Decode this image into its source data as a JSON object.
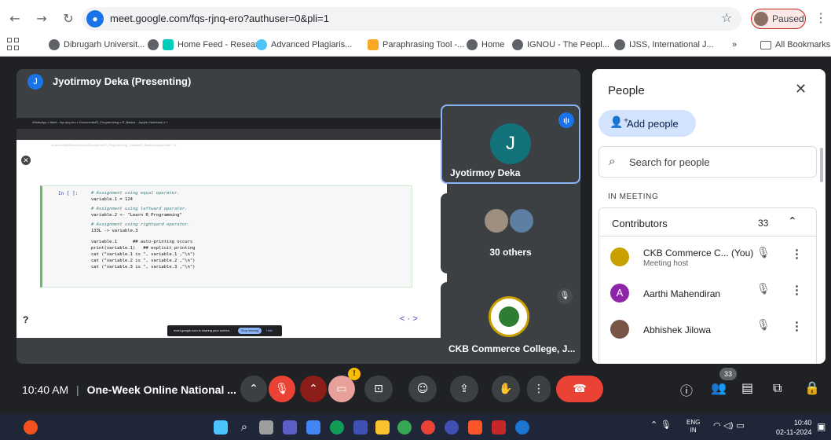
{
  "browser": {
    "url": "meet.google.com/fqs-rjnq-ero?authuser=0&pli=1",
    "profile_status": "Paused",
    "bookmarks": [
      "Dibrugarh Universit...",
      "Home Feed - Resear...",
      "Advanced Plagiaris...",
      "Paraphrasing Tool -...",
      "Home",
      "IGNOU - The Peopl...",
      "IJSS, International J..."
    ],
    "bookmarks_overflow": "»",
    "all_bookmarks": "All Bookmarks"
  },
  "stage": {
    "presenter_initial": "J",
    "presenter_label": "Jyotirmoy Deka (Presenting)"
  },
  "shared_screen": {
    "tabs_text": "WhatsApp   x  Meet - fqs-rjnq-ero   x   Documents/R_Programming   x   R_Basics - Jupyter Notebook   x  +",
    "url_text": "localhost:8888/notebooks/Documents/R_Programming_Tutorial/R_Basics.ipynb#Slide-7-9",
    "cell_prompt": "In [ ]:",
    "code_lines": [
      {
        "text": "# Assignment using equal operator.",
        "comment": true
      },
      {
        "text": "variable.1 = 124",
        "comment": false
      },
      {
        "text": "# Assignment using leftward operator.",
        "comment": true
      },
      {
        "text": "variable.2 <- \"Learn R Programming\"",
        "comment": false
      },
      {
        "text": "# Assignment using rightward operator.",
        "comment": true
      },
      {
        "text": "133L -> variable.3",
        "comment": false
      },
      {
        "text": "variable.1      ## auto-printing occurs",
        "comment": false
      },
      {
        "text": "print(variable.1)   ## explicit printing",
        "comment": false
      },
      {
        "text": "cat (\"variable.1 is \", variable.1 ,\"\\n\")",
        "comment": false
      },
      {
        "text": "cat (\"variable.2 is \", variable.2 ,\"\\n\")",
        "comment": false
      },
      {
        "text": "cat (\"variable.3 is \", variable.3 ,\"\\n\")",
        "comment": false
      }
    ],
    "help_mark": "?",
    "pager": "< · >",
    "share_text": "meet.google.com is sharing your screen.",
    "stop_sharing": "Stop sharing",
    "hide": "Hide"
  },
  "tiles": {
    "jyotirmoy": {
      "initial": "J",
      "name": "Jyotirmoy Deka"
    },
    "others": {
      "label": "30 others"
    },
    "ckb": {
      "name": "CKB Commerce College, J..."
    }
  },
  "people_panel": {
    "title": "People",
    "add_people": "Add people",
    "search_placeholder": "Search for people",
    "section": "IN MEETING",
    "group_label": "Contributors",
    "group_count": "33",
    "participants": [
      {
        "name": "CKB Commerce C... (You)",
        "sub": "Meeting host",
        "avatar_color": "#c8a000",
        "initial": ""
      },
      {
        "name": "Aarthi Mahendiran",
        "sub": "",
        "avatar_color": "#8e24aa",
        "initial": "A"
      },
      {
        "name": "Abhishek Jilowa",
        "sub": "",
        "avatar_color": "#795548",
        "initial": ""
      }
    ]
  },
  "meet_bar": {
    "time": "10:40 AM",
    "separator": "|",
    "meeting_title": "One-Week Online National ...",
    "people_count": "33",
    "warning": "!"
  },
  "taskbar": {
    "lang_top": "ENG",
    "lang_bottom": "IN",
    "time": "10:40",
    "date": "02-11-2024"
  },
  "colors": {
    "meet_background": "#202124",
    "tile_background": "#3c4043",
    "accent_blue": "#1a73e8",
    "end_call_red": "#ea4335"
  }
}
